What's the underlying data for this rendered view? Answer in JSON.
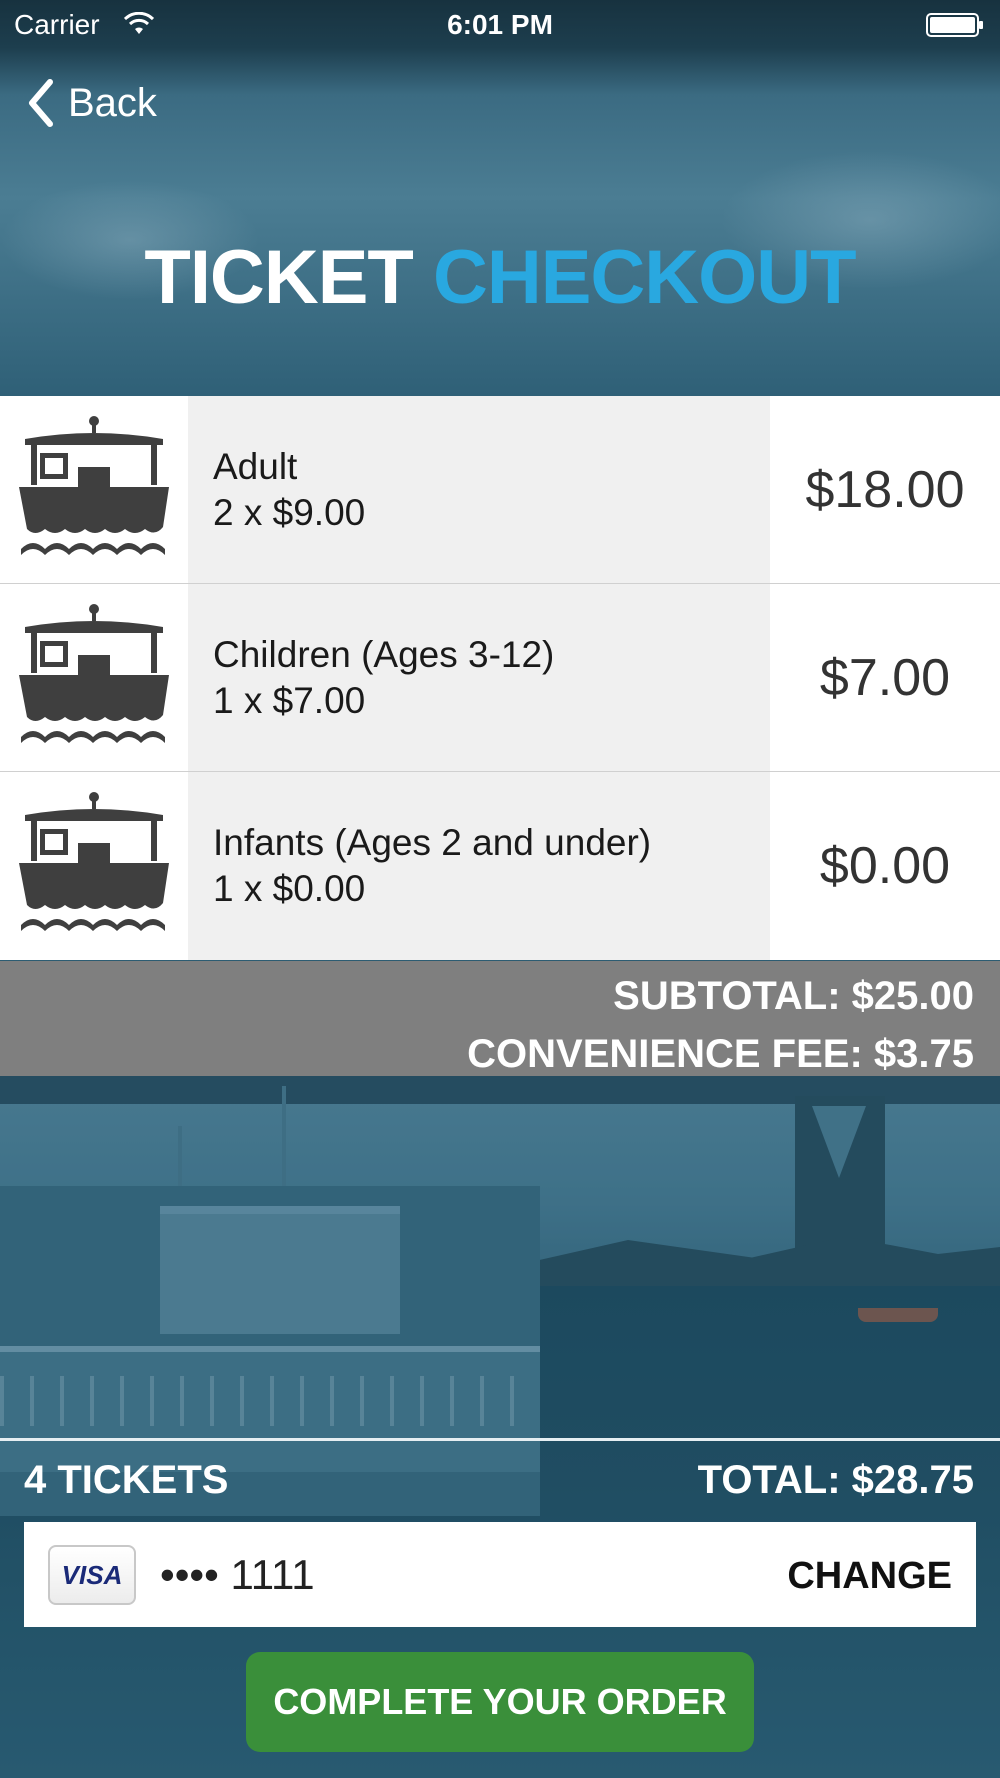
{
  "status_bar": {
    "carrier": "Carrier",
    "time": "6:01 PM"
  },
  "nav": {
    "back_label": "Back"
  },
  "title": {
    "part1": "TICKET",
    "part2": "CHECKOUT"
  },
  "colors": {
    "title_accent": "#29a8e0",
    "button_green": "#3a8f3a",
    "summary_gray": "#7f7f7f"
  },
  "tickets": [
    {
      "name": "Adult",
      "quantity_text": "2 x $9.00",
      "price": "$18.00",
      "icon": "ferry-icon"
    },
    {
      "name": "Children (Ages 3-12)",
      "quantity_text": "1 x $7.00",
      "price": "$7.00",
      "icon": "ferry-icon"
    },
    {
      "name": "Infants (Ages 2 and under)",
      "quantity_text": "1 x $0.00",
      "price": "$0.00",
      "icon": "ferry-icon"
    }
  ],
  "summary": {
    "subtotal": "SUBTOTAL: $25.00",
    "convenience_fee": "CONVENIENCE FEE: $3.75"
  },
  "order": {
    "tickets_count": "4 TICKETS",
    "total": "TOTAL: $28.75"
  },
  "payment": {
    "card_brand": "VISA",
    "card_masked": "•••• 1111",
    "change_label": "CHANGE"
  },
  "complete_button": {
    "label": "COMPLETE YOUR ORDER"
  }
}
